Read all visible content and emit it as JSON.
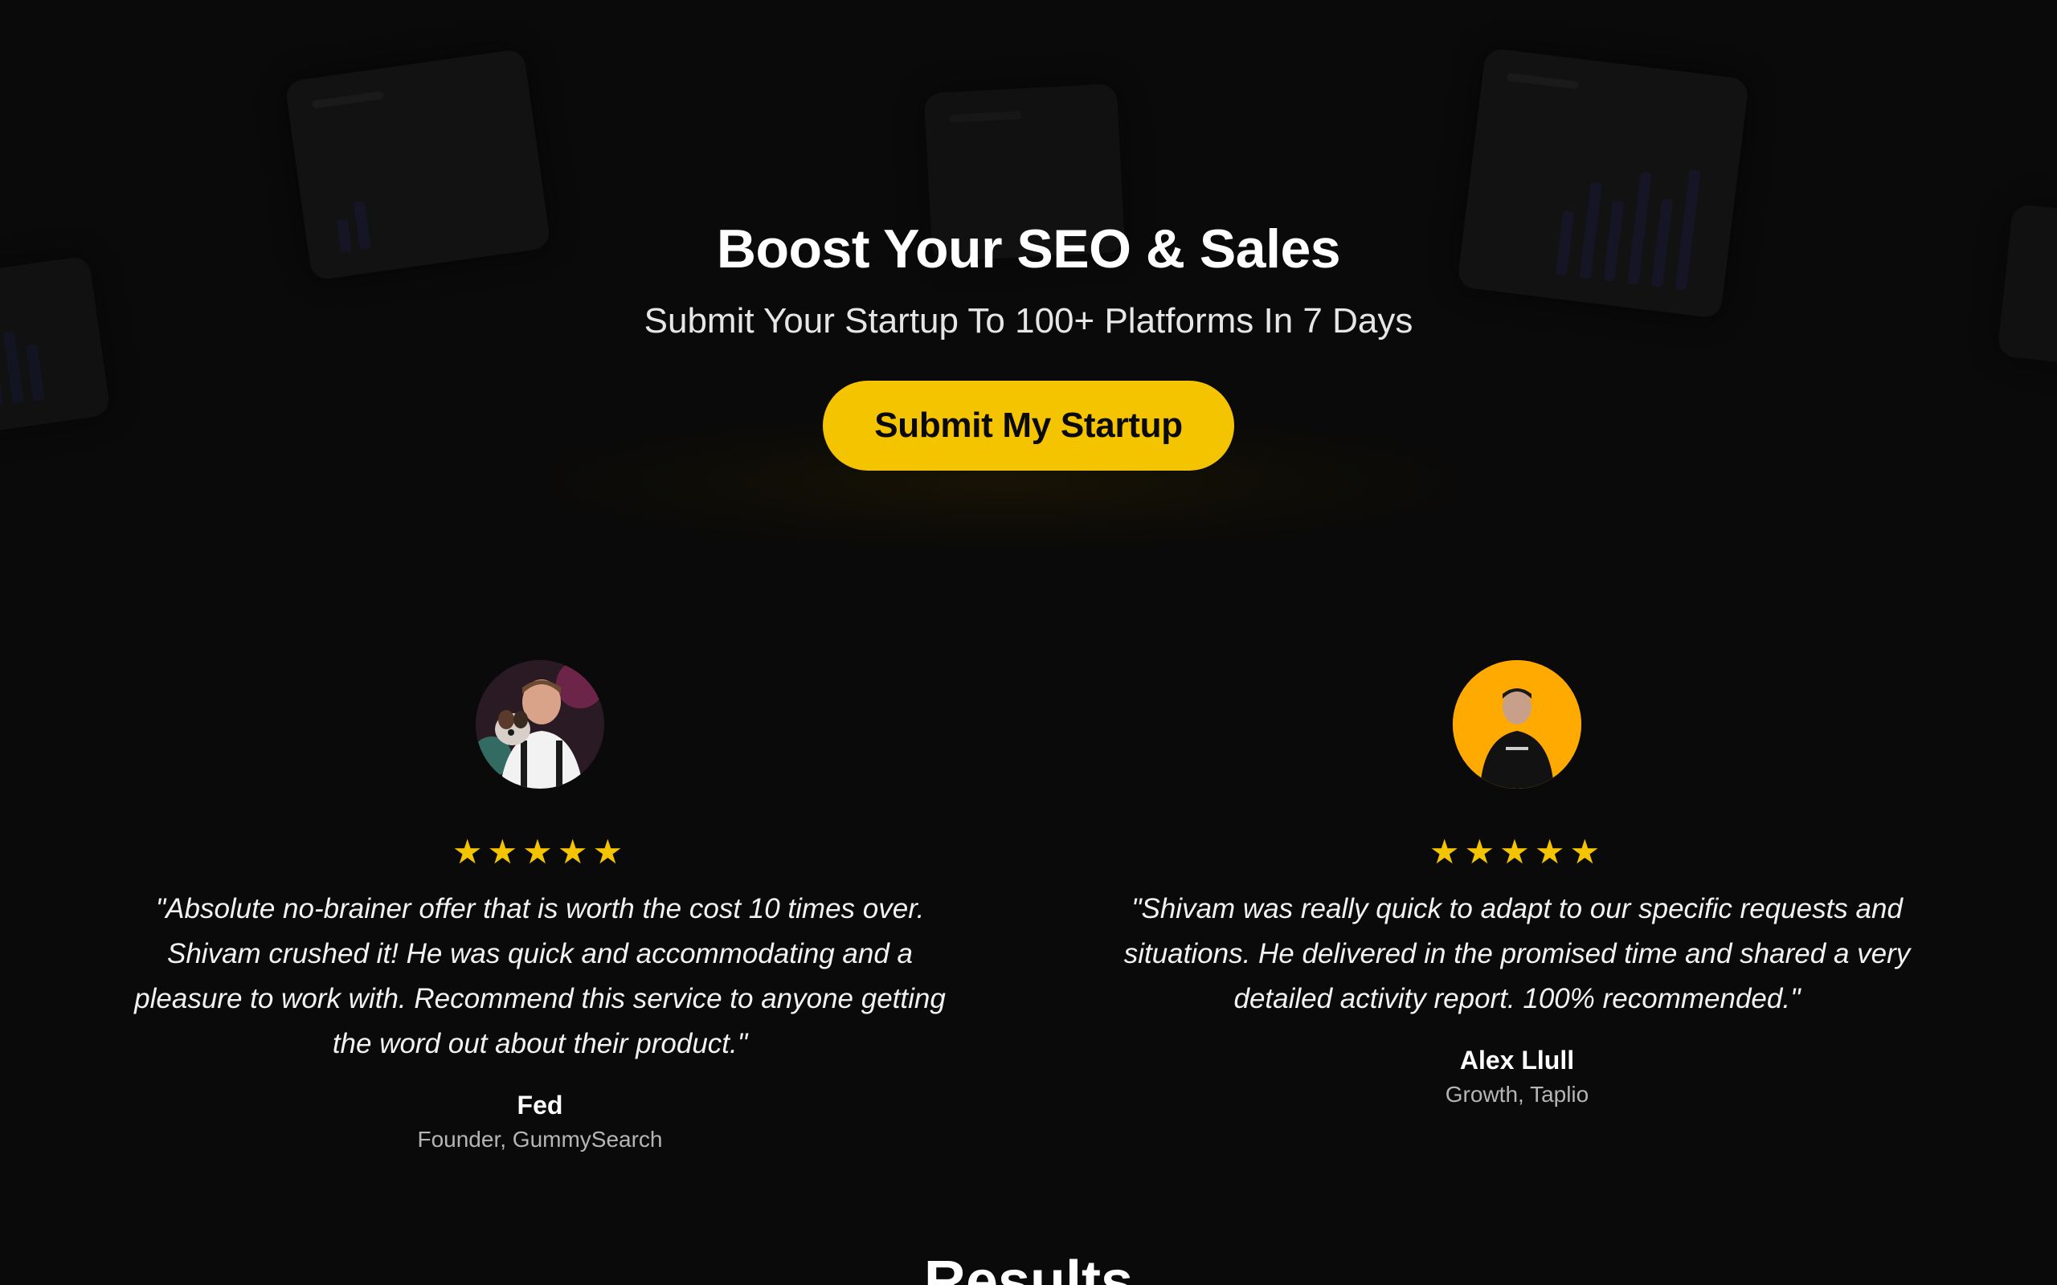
{
  "hero": {
    "title": "Boost Your SEO & Sales",
    "subtitle": "Submit Your Startup To 100+ Platforms In 7 Days",
    "cta_label": "Submit My Startup"
  },
  "testimonials": [
    {
      "stars": "★★★★★",
      "rating": 5,
      "quote": "\"Absolute no-brainer offer that is worth the cost 10 times over. Shivam crushed it! He was quick and accommodating and a pleasure to work with. Recommend this service to anyone getting the word out about their product.\"",
      "name": "Fed",
      "role": "Founder, GummySearch"
    },
    {
      "stars": "★★★★★",
      "rating": 5,
      "quote": "\"Shivam was really quick to adapt to our specific requests and situations. He delivered in the promised time and shared a very detailed activity report. 100% recommended.\"",
      "name": "Alex Llull",
      "role": "Growth, Taplio"
    }
  ],
  "results": {
    "title": "Results"
  },
  "colors": {
    "background": "#0a0a0a",
    "accent": "#f5c400",
    "text": "#ffffff",
    "muted": "#b5b5b5"
  }
}
